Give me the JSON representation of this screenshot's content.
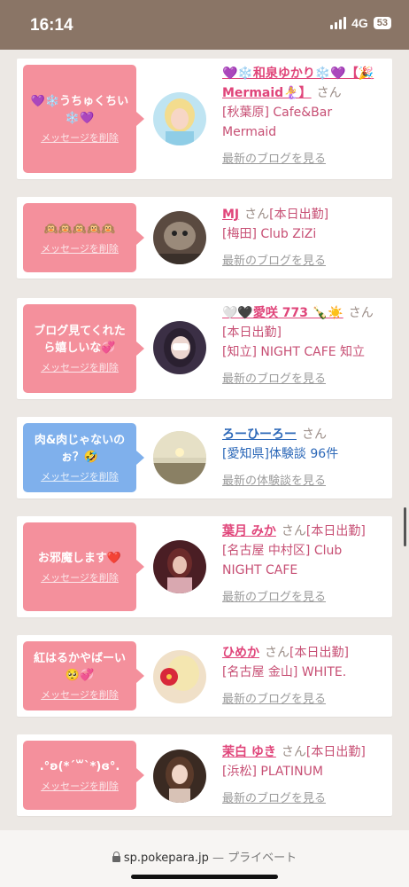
{
  "status_bar": {
    "time": "16:14",
    "network": "4G",
    "battery": "53"
  },
  "colors": {
    "pink_bubble": "#f4909c",
    "blue_bubble": "#7fb0ec",
    "name_pink": "#e0457a",
    "name_blue": "#2c68b8",
    "header": "#8a7566"
  },
  "messages": [
    {
      "message": "💜❄️うちゅくちい❄️💜",
      "delete_label": "メッセージを削除",
      "name": "💜❄️和泉ゆかり❄️💜【🎉Mermaid🧜‍♀️】",
      "honorific": "さん",
      "status": "",
      "shop": "[秋葉原] Cafe&Bar Mermaid",
      "link": "最新のブログを見る",
      "avatar_icon": "blonde-woman-avatar"
    },
    {
      "message": "🙉🙉🙉🙉🙉",
      "delete_label": "メッセージを削除",
      "name": "MJ",
      "honorific": "さん",
      "status": "[本日出勤]",
      "shop": "[梅田] Club ZiZi",
      "link": "最新のブログを見る",
      "avatar_icon": "creature-avatar"
    },
    {
      "message": "ブログ見てくれたら嬉しいな💞",
      "delete_label": "メッセージを削除",
      "name": "🤍🖤愛咲 773 🍾☀️",
      "honorific": "さん",
      "status": "[本日出勤]",
      "shop": "[知立] NIGHT CAFE 知立",
      "link": "最新のブログを見る",
      "avatar_icon": "woman-avatar"
    },
    {
      "message": "肉&肉じゃないのぉ？🤣",
      "delete_label": "メッセージを削除",
      "name": "ろーひーろー",
      "honorific": "さん",
      "status": "",
      "shop": "[愛知県]体験談 96件",
      "link": "最新の体験談を見る",
      "avatar_icon": "sunset-avatar"
    },
    {
      "message": "お邪魔します❤️",
      "delete_label": "メッセージを削除",
      "name": "葉月 みか",
      "honorific": "さん",
      "status": "[本日出勤]",
      "shop": "[名古屋 中村区] Club NIGHT CAFE",
      "link": "最新のブログを見る",
      "avatar_icon": "woman-avatar"
    },
    {
      "message": "紅はるかやばーい🥺💞",
      "delete_label": "メッセージを削除",
      "name": "ひめか",
      "honorific": "さん",
      "status": "[本日出勤]",
      "shop": "[名古屋 金山] WHITE.",
      "link": "最新のブログを見る",
      "avatar_icon": "hibiscus-avatar"
    },
    {
      "message": ".°ʚ(*´꒳`*)ɞ°.",
      "delete_label": "メッセージを削除",
      "name": "茉白 ゆき",
      "honorific": "さん",
      "status": "[本日出勤]",
      "shop": "[浜松] PLATINUM",
      "link": "最新のブログを見る",
      "avatar_icon": "woman-avatar"
    }
  ],
  "url_bar": {
    "domain": "sp.pokepara.jp",
    "privacy": "— プライベート"
  }
}
